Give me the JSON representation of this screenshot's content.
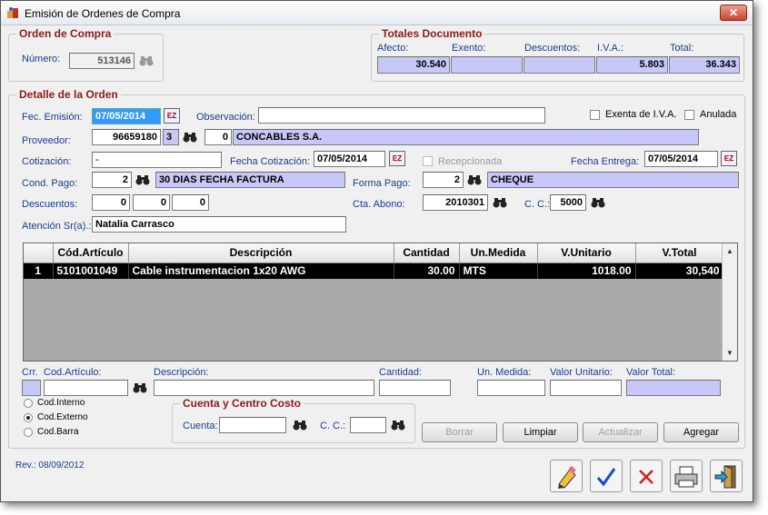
{
  "window": {
    "title": "Emisión de Ordenes de Compra",
    "close_label": "✕"
  },
  "orden": {
    "legend": "Orden de Compra",
    "numero_label": "Número:",
    "numero": "513146"
  },
  "totales": {
    "legend": "Totales Documento",
    "afecto_label": "Afecto:",
    "afecto": "30.540",
    "exento_label": "Exento:",
    "exento": "",
    "descuentos_label": "Descuentos:",
    "descuentos": "",
    "iva_label": "I.V.A.:",
    "iva": "5.803",
    "total_label": "Total:",
    "total": "36.343"
  },
  "detalle": {
    "legend": "Detalle de la Orden",
    "fec_emision_label": "Fec. Emisión:",
    "fec_emision": "07/05/2014",
    "observacion_label": "Observación:",
    "observacion": "",
    "exenta_label": "Exenta de I.V.A.",
    "anulada_label": "Anulada",
    "proveedor_label": "Proveedor:",
    "proveedor_rut": "96659180",
    "proveedor_dv": "3",
    "proveedor_num": "0",
    "proveedor_nombre": "CONCABLES S.A.",
    "cotizacion_label": "Cotización:",
    "cotizacion": "-",
    "fecha_cotizacion_label": "Fecha Cotización:",
    "fecha_cotizacion": "07/05/2014",
    "recepcionada_label": "Recepcionada",
    "fecha_entrega_label": "Fecha Entrega:",
    "fecha_entrega": "07/05/2014",
    "cond_pago_label": "Cond. Pago:",
    "cond_pago_code": "2",
    "cond_pago_desc": "30 DIAS FECHA FACTURA",
    "forma_pago_label": "Forma Pago:",
    "forma_pago_code": "2",
    "forma_pago_desc": "CHEQUE",
    "descuentos_label": "Descuentos:",
    "desc1": "0",
    "desc2": "0",
    "desc3": "0",
    "cta_abono_label": "Cta. Abono:",
    "cta_abono": "2010301",
    "cc_label": "C. C.:",
    "cc": "5000",
    "atencion_label": "Atención Sr(a).:",
    "atencion": "Natalia Carrasco"
  },
  "grid": {
    "columns": [
      "",
      "Cód.Artículo",
      "Descripción",
      "Cantidad",
      "Un.Medida",
      "V.Unitario",
      "V.Total"
    ],
    "rows": [
      [
        "1",
        "5101001049",
        "Cable instrumentacion 1x20 AWG",
        "30.00",
        "MTS",
        "1018.00",
        "30,540"
      ]
    ]
  },
  "entry": {
    "crr_label": "Crr.",
    "cod_label": "Cod.Artículo:",
    "desc_label": "Descripción:",
    "cant_label": "Cantidad:",
    "um_label": "Un. Medida:",
    "vu_label": "Valor Unitario:",
    "vt_label": "Valor Total:"
  },
  "radios": {
    "interno": "Cod.Interno",
    "externo": "Cod.Externo",
    "barra": "Cod.Barra"
  },
  "ccosto": {
    "legend": "Cuenta y Centro Costo",
    "cuenta_label": "Cuenta:",
    "cc_label": "C. C.:"
  },
  "buttons": {
    "borrar": "Borrar",
    "limpiar": "Limpiar",
    "actualizar": "Actualizar",
    "agregar": "Agregar"
  },
  "footer": {
    "rev": "Rev.: 08/09/2012"
  },
  "icons": {
    "binoculars": "binoculars-icon",
    "calendar": "calendar-icon"
  }
}
